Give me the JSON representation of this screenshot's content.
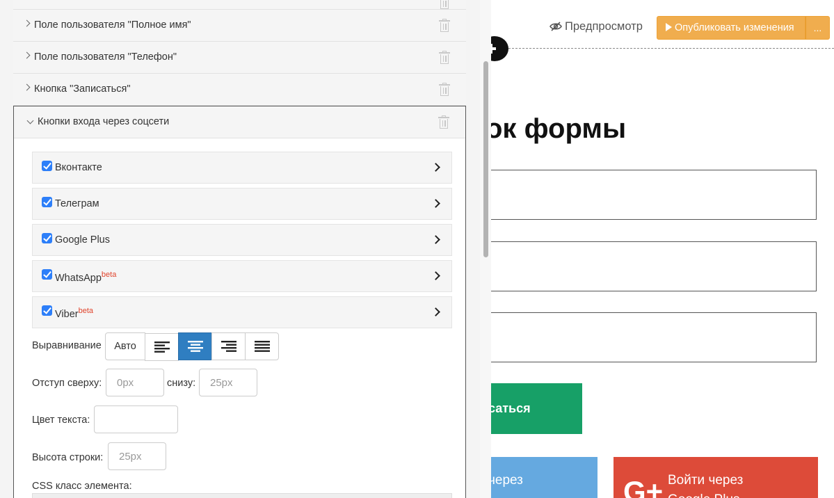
{
  "accordion": {
    "items": [
      {
        "label": "Поле пользователя \"Полное имя\""
      },
      {
        "label": "Поле пользователя \"Телефон\""
      },
      {
        "label": "Кнопка \"Записаться\""
      },
      {
        "label": "Кнопки входа через соцсети"
      }
    ]
  },
  "social": {
    "items": [
      {
        "label": "Вконтакте",
        "checked": true,
        "badge": ""
      },
      {
        "label": "Телеграм",
        "checked": true,
        "badge": ""
      },
      {
        "label": "Google Plus",
        "checked": true,
        "badge": ""
      },
      {
        "label": "WhatsApp",
        "checked": true,
        "badge": "beta"
      },
      {
        "label": "Viber",
        "checked": true,
        "badge": "beta"
      }
    ]
  },
  "settings": {
    "alignment_label": "Выравнивание",
    "alignment_options": [
      "Авто",
      "left",
      "center",
      "right",
      "justify"
    ],
    "alignment_selected": "center",
    "alignment_auto_label": "Авто",
    "margin_top_label": "Отступ сверху:",
    "margin_top_placeholder": "0px",
    "margin_bottom_label": "снизу:",
    "margin_bottom_placeholder": "25px",
    "text_color_label": "Цвет текста:",
    "text_color_value": "",
    "line_height_label": "Высота строки:",
    "line_height_placeholder": "25px",
    "css_class_label": "CSS класс элемента:"
  },
  "toolbar": {
    "preview_label": "Предпросмотр",
    "publish_label": "Опубликовать изменения",
    "more_label": "..."
  },
  "preview": {
    "form_title_visible": "ок формы",
    "submit_visible": "саться",
    "vk_line1": "через",
    "vk_line2": "",
    "gp_line1": "Войти через",
    "gp_line2": "Google Plus",
    "gp_logo": "G+"
  },
  "colors": {
    "accent_blue": "#2f7ec1",
    "checkbox_blue": "#2d7ff9",
    "publish_orange": "#f0ad4e",
    "submit_green": "#17a067",
    "vk_blue": "#65a9e0",
    "gp_red": "#dd4b39",
    "beta_red": "#e0442c"
  }
}
